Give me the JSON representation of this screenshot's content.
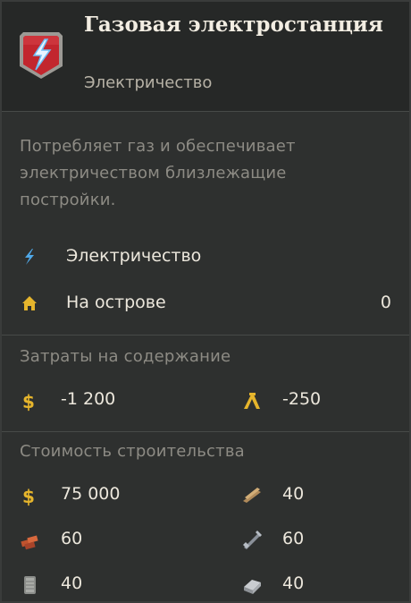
{
  "building": {
    "title": "Газовая электростанция",
    "category": "Электричество",
    "description": "Потребляет газ и обеспечивает электричеством близлежащие постройки."
  },
  "effects": [
    {
      "icon": "lightning-icon",
      "label": "Электричество",
      "value": ""
    },
    {
      "icon": "house-icon",
      "label": "На острове",
      "value": "0"
    }
  ],
  "upkeep": {
    "title": "Затраты на содержание",
    "items": [
      {
        "icon": "coin-icon",
        "value": "-1 200"
      },
      {
        "icon": "workforce-icon",
        "value": "-250"
      }
    ]
  },
  "construction": {
    "title": "Стоимость строительства",
    "items": [
      {
        "icon": "coin-icon",
        "value": "75 000"
      },
      {
        "icon": "timber-icon",
        "value": "40"
      },
      {
        "icon": "bricks-icon",
        "value": "60"
      },
      {
        "icon": "steel-beams-icon",
        "value": "60"
      },
      {
        "icon": "windows-icon",
        "value": "40"
      },
      {
        "icon": "reinforced-concrete-icon",
        "value": "40"
      }
    ]
  },
  "colors": {
    "accent_red": "#c2262e",
    "lightning_blue": "#4fa8e8",
    "coin_gold": "#e6b52c"
  }
}
